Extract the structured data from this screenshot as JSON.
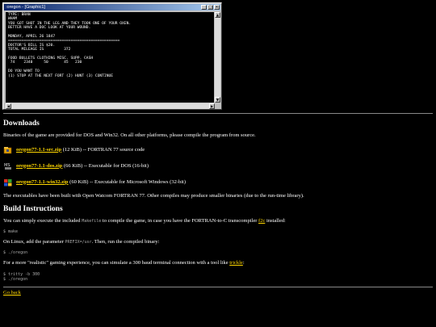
{
  "window": {
    "title": ":oregon - [Graphic1]",
    "minimize": "_",
    "maximize": "□",
    "close": "×",
    "screen_text": "TYPE: BRAN\nWHAM\nYOU GOT SHOT IN THE LEG AND THEY TOOK ONE OF YOUR OXEN.\nBETTER HAVE A DOC LOOK AT YOUR WOUND.\n\nMONDAY, APRIL 26 1847\n==================================================\nDOCTOR'S BILL IS $20.\nTOTAL MILEAGE IS         372\n\nFOOD BULLETS CLOTHING MISC. SUPP. CASH\n 74    2340     50       45   230\n\nDO YOU WANT TO\n(1) STOP AT THE NEXT FORT (2) HUNT (3) CONTINUE",
    "scroll_up": "▲",
    "scroll_down": "▼",
    "scroll_left": "◀",
    "scroll_right": "▶"
  },
  "downloads": {
    "heading": "Downloads",
    "intro": "Binaries of the game are provided for DOS and Win32. On all other platforms, please compile the program from source.",
    "items": [
      {
        "link": "oregon77-1.1-src.zip",
        "desc": "(12 KiB) -- FORTRAN 77 source code",
        "icon": "archive-icon"
      },
      {
        "link": "oregon77-1.1-dos.zip",
        "desc": "(66 KiB) -- Executable for DOS (16-bit)",
        "icon": "msdos-icon"
      },
      {
        "link": "oregon77-1.1-win32.zip",
        "desc": "(60 KiB) -- Executable for Microsoft Windows (32-bit)",
        "icon": "windows-icon"
      }
    ],
    "note": "The executables have been built with Open Watcom FORTRAN 77. Other compiles may produce smaller binaries (due to the run-time library)."
  },
  "build": {
    "heading": "Build Instructions",
    "p1_before": "You can simply execute the included",
    "p1_code": "Makefile",
    "p1_middle": "to compile the game, in case you have the FORTRAN-to-C transcompiler",
    "p1_link": "f2c",
    "p1_after": "installed:",
    "cmd1": "$ make",
    "p2_before": "On Linux, add the parameter",
    "p2_code": "PREFIX=/usr",
    "p2_after": ". Then, run the compiled binary:",
    "cmd2": "$ ./oregon",
    "p3_before": "For a more \"realistic\" gaming experience, you can simulate a 300 baud terminal connection with a tool like",
    "p3_link": "trickle",
    "p3_after": ":",
    "cmd3": "$ tritty -b 300\n$ ./oregon"
  },
  "footer": {
    "back_link": "Go back"
  }
}
